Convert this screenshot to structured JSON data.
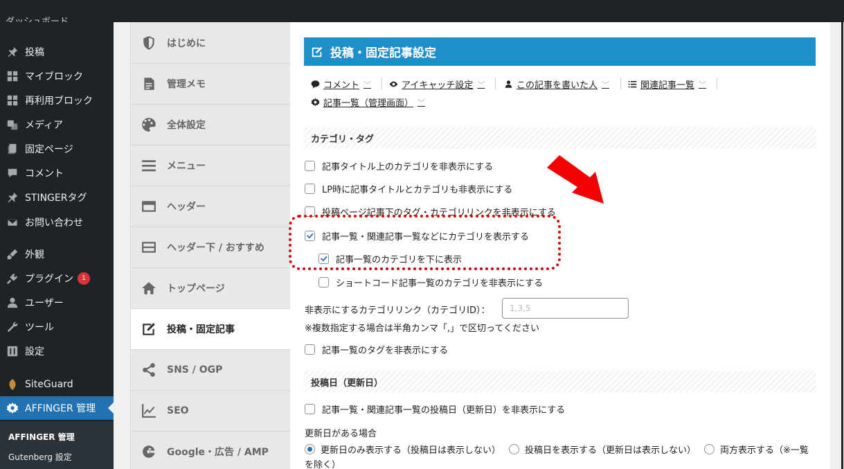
{
  "topbar": {
    "clipped_label": "ダッシュボード"
  },
  "wp_menu": {
    "items": [
      {
        "label": "投稿",
        "icon": "pin-icon"
      },
      {
        "label": "マイブロック",
        "icon": "blocks-icon"
      },
      {
        "label": "再利用ブロック",
        "icon": "blocks-icon"
      },
      {
        "label": "メディア",
        "icon": "media-icon"
      },
      {
        "label": "固定ページ",
        "icon": "page-icon"
      },
      {
        "label": "コメント",
        "icon": "comment-icon"
      },
      {
        "label": "STINGERタグ",
        "icon": "pin-icon"
      },
      {
        "label": "お問い合わせ",
        "icon": "mail-icon"
      },
      {
        "label": "外観",
        "icon": "brush-icon"
      },
      {
        "label": "プラグイン",
        "icon": "plugin-icon",
        "badge": "1"
      },
      {
        "label": "ユーザー",
        "icon": "user-icon"
      },
      {
        "label": "ツール",
        "icon": "wrench-icon"
      },
      {
        "label": "設定",
        "icon": "settings-icon"
      },
      {
        "label": "SiteGuard",
        "icon": "siteguard-icon"
      },
      {
        "label": "AFFINGER 管理",
        "icon": "gear-icon"
      }
    ],
    "sub_items": [
      "AFFINGER 管理",
      "Gutenberg 設定"
    ]
  },
  "aff_nav": {
    "tabs": [
      {
        "label": "はじめに",
        "icon": "shield-icon"
      },
      {
        "label": "管理メモ",
        "icon": "memo-icon"
      },
      {
        "label": "全体設定",
        "icon": "palette-icon"
      },
      {
        "label": "メニュー",
        "icon": "menu-icon"
      },
      {
        "label": "ヘッダー",
        "icon": "header-icon"
      },
      {
        "label": "ヘッダー下 / おすすめ",
        "icon": "header-below-icon"
      },
      {
        "label": "トップページ",
        "icon": "home-icon"
      },
      {
        "label": "投稿・固定記事",
        "icon": "edit-icon"
      },
      {
        "label": "SNS / OGP",
        "icon": "share-icon"
      },
      {
        "label": "SEO",
        "icon": "chart-icon"
      },
      {
        "label": "Google・広告 / AMP",
        "icon": "google-icon"
      }
    ]
  },
  "main": {
    "title": "投稿・固定記事設定",
    "subnav": [
      {
        "label": "コメント",
        "icon": "comment-icon"
      },
      {
        "label": "アイキャッチ設定",
        "icon": "eye-icon"
      },
      {
        "label": "この記事を書いた人",
        "icon": "user-icon"
      },
      {
        "label": "関連記事一覧",
        "icon": "list-icon"
      },
      {
        "label": "記事一覧（管理画面）",
        "icon": "gear-icon"
      }
    ],
    "section1": "カテゴリ・タグ",
    "options": [
      "記事タイトル上のカテゴリを非表示にする",
      "LP時に記事タイトルとカテゴリも非表示にする",
      "投稿ページ記事下のタグ・カテゴリリンクを非表示にする",
      "記事一覧・関連記事一覧などにカテゴリを表示する",
      "記事一覧のカテゴリを下に表示",
      "ショートコード記事一覧のカテゴリを非表示にする"
    ],
    "hide_cat_label": "非表示にするカテゴリリンク（カテゴリID）：",
    "hide_cat_placeholder": "1,3,5",
    "hide_cat_note": "※複数指定する場合は半角カンマ「,」で区切ってください",
    "tag_option": "記事一覧のタグを非表示にする",
    "section2": "投稿日（更新日）",
    "date_option": "記事一覧・関連記事一覧の投稿日（更新日）を非表示にする",
    "update_label": "更新日がある場合",
    "radios": [
      "更新日のみ表示する（投稿日は表示しない）",
      "投稿日を表示する（更新日は表示しない）",
      "両方表示する（※一覧"
    ],
    "radio_wrap": "を除く）"
  },
  "accent_colors": {
    "header": "#1f8fc9",
    "wp_active": "#2271b1",
    "annotation": "#d90000"
  }
}
